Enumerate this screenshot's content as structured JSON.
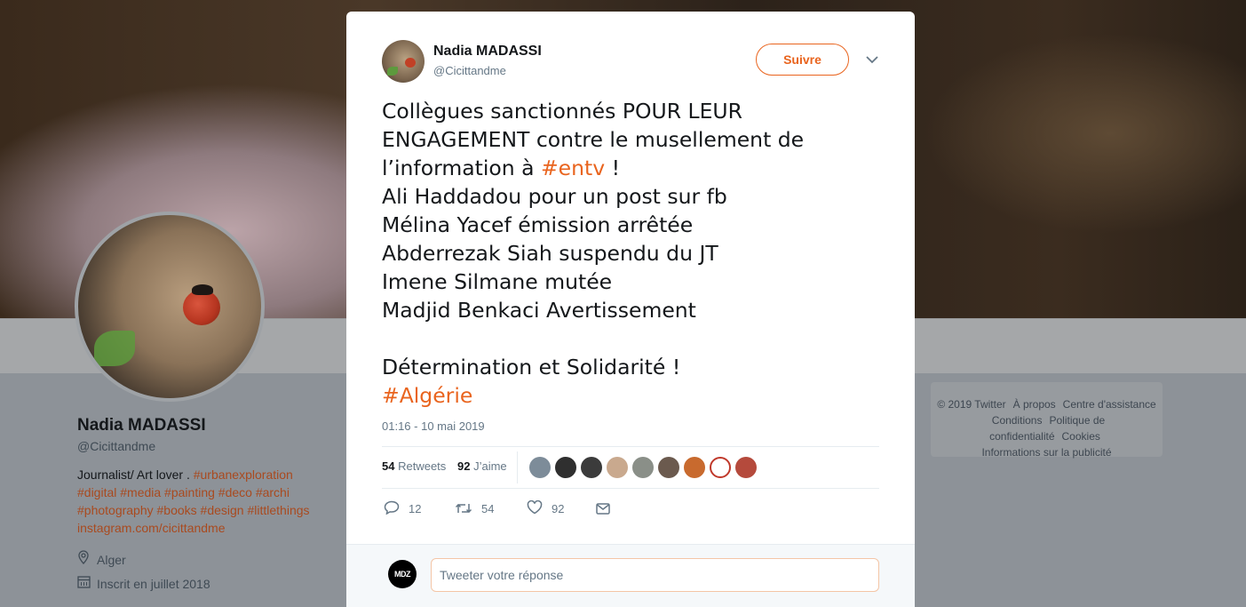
{
  "profile": {
    "name": "Nadia MADASSI",
    "handle": "@Cicittandme",
    "bio_text": "Journalist/ Art lover . ",
    "bio_tags_line1": "#urbanexploration",
    "bio_tags_line2": "#digital #media #painting #deco #archi",
    "bio_tags_line3": "#photography #books #design #littlethings",
    "bio_link": "instagram.com/cicittandme",
    "location": "Alger",
    "joined": "Inscrit en juillet 2018",
    "location_icon": "location-pin-icon",
    "calendar_icon": "calendar-icon"
  },
  "footer": {
    "copyright": "© 2019 Twitter",
    "about": "À propos",
    "help": "Centre d'assistance",
    "terms": "Conditions",
    "privacy": "Politique de confidentialité",
    "cookies": "Cookies",
    "ads": "Informations sur la publicité"
  },
  "tweet": {
    "author_name": "Nadia MADASSI",
    "author_handle": "@Cicittandme",
    "follow_label": "Suivre",
    "menu_icon": "chevron-down-icon",
    "text_part1": "Collègues sanctionnés POUR LEUR ENGAGEMENT contre  le musellement de l’information à ",
    "hashtag1": "#entv",
    "text_part2": " !\nAli Haddadou pour un post sur fb\nMélina Yacef émission  arrêtée\nAbderrezak Siah suspendu du JT\nImene Silmane mutée\nMadjid Benkaci Avertissement\n\nDétermination et Solidarité !\n",
    "hashtag2": "#Algérie",
    "timestamp": "01:16 - 10 mai 2019",
    "retweets_count": "54",
    "retweets_label": "Retweets",
    "likes_count": "92",
    "likes_label": "J’aime",
    "liker_colors": [
      "#7d8c99",
      "#2f2f2f",
      "#3b3b3b",
      "#c9a98e",
      "#8a8f88",
      "#6b5a4e",
      "#c86a2e",
      "#ffffff",
      "#b54a3c"
    ],
    "actions": {
      "reply_icon": "reply-icon",
      "reply_count": "12",
      "retweet_icon": "retweet-icon",
      "retweet_count": "54",
      "like_icon": "heart-icon",
      "like_count": "92",
      "dm_icon": "envelope-icon"
    }
  },
  "reply": {
    "avatar_text": "MDZ",
    "placeholder": "Tweeter votre réponse"
  },
  "colors": {
    "accent": "#e9641e",
    "text_primary": "#14171a",
    "text_secondary": "#657786"
  }
}
